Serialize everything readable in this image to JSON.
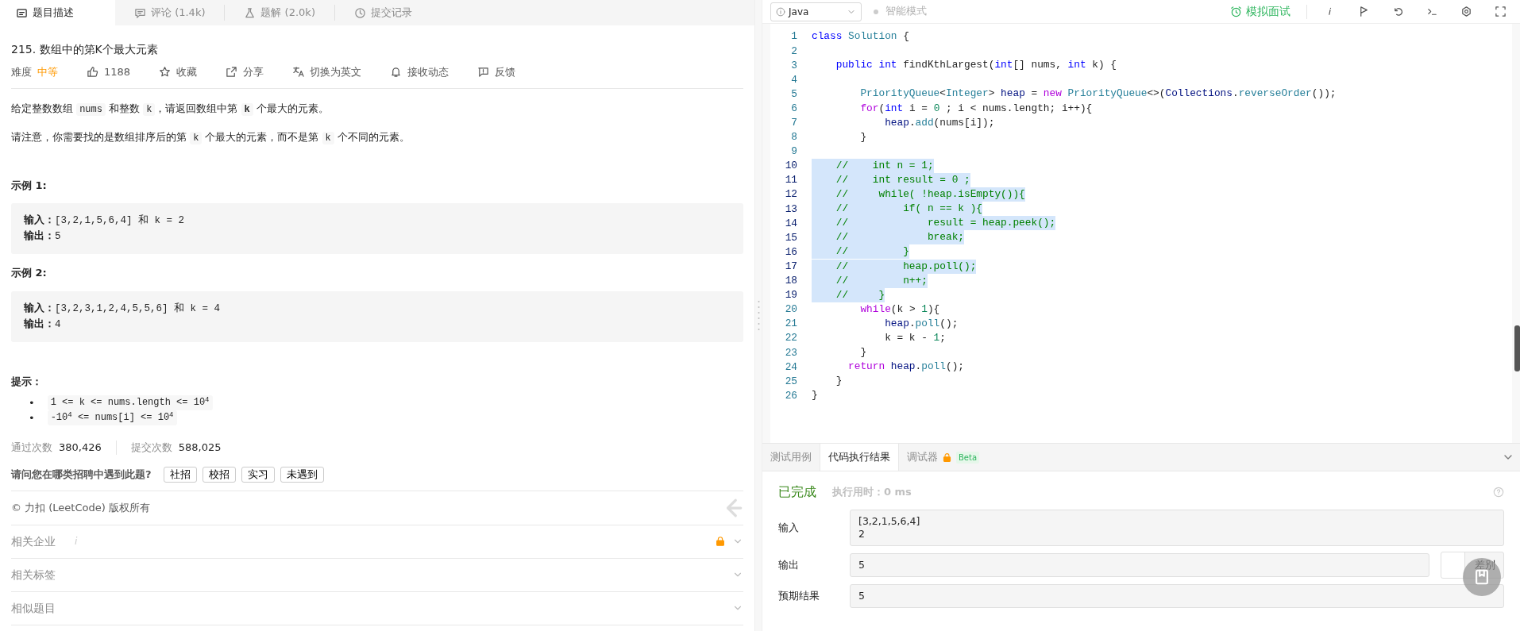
{
  "left_tabs": [
    {
      "label": "题目描述",
      "selected": true
    },
    {
      "label": "评论 (1.4k)",
      "selected": false
    },
    {
      "label": "题解 (2.0k)",
      "selected": false
    },
    {
      "label": "提交记录",
      "selected": false
    }
  ],
  "problem": {
    "title": "215. 数组中的第K个最大元素",
    "difficulty_label": "难度",
    "difficulty": "中等",
    "actions": [
      {
        "label": "1188"
      },
      {
        "label": "收藏"
      },
      {
        "label": "分享"
      },
      {
        "label": "切换为英文"
      },
      {
        "label": "接收动态"
      },
      {
        "label": "反馈"
      }
    ],
    "paragraphs": [
      [
        {
          "kind": "text",
          "text": "给定整数数组 "
        },
        {
          "kind": "code",
          "text": "nums"
        },
        {
          "kind": "text",
          "text": " 和整数 "
        },
        {
          "kind": "code",
          "text": "k"
        },
        {
          "kind": "text",
          "text": "，请返回数组中第 "
        },
        {
          "kind": "strongcode",
          "text": "k"
        },
        {
          "kind": "text",
          "text": " 个最大的元素。"
        }
      ],
      [
        {
          "kind": "text",
          "text": "请注意，你需要找的是数组排序后的第 "
        },
        {
          "kind": "code",
          "text": "k"
        },
        {
          "kind": "text",
          "text": " 个最大的元素，而不是第 "
        },
        {
          "kind": "code",
          "text": "k"
        },
        {
          "kind": "text",
          "text": " 个不同的元素。"
        }
      ]
    ],
    "examples": [
      {
        "title": "示例 1:",
        "lines": [
          "**输入：**[3,2,1,5,6,4] 和 k = 2",
          "**输出：**5"
        ]
      },
      {
        "title": "示例 2:",
        "lines": [
          "**输入：**[3,2,3,1,2,4,5,5,6] 和 k = 4",
          "**输出：**4"
        ]
      }
    ],
    "hints_title": "提示：",
    "hints": [
      {
        "bullet": "•",
        "text": "1 <= k <= nums.length <= 10$^{4}$"
      },
      {
        "bullet": "•",
        "text": "-10$^{4}$  <= nums[i] <= 10$^{4}$"
      }
    ],
    "stats": [
      {
        "label": "通过次数",
        "value": "380,426"
      },
      {
        "label": "提交次数",
        "value": "588,025"
      }
    ],
    "survey": {
      "question": "请问您在哪类招聘中遇到此题?",
      "options": [
        "社招",
        "校招",
        "实习",
        "未遇到"
      ]
    },
    "copyright": "© 力扣 (LeetCode) 版权所有",
    "sections": [
      {
        "label": "相关企业",
        "info": "i",
        "locked": true
      },
      {
        "label": "相关标签",
        "locked": false
      },
      {
        "label": "相似题目",
        "locked": false
      }
    ]
  },
  "toolbar": {
    "language": "Java",
    "smart_mode": "智能模式",
    "mock_interview": "模拟面试"
  },
  "code_lines": [
    {
      "number": "1",
      "selected": false,
      "tokens": [
        {
          "text": "class",
          "kind": "keyword"
        },
        {
          "text": " Solution",
          "kind": "type"
        },
        {
          "text": " {"
        }
      ]
    },
    {
      "number": "2",
      "selected": false
    },
    {
      "number": "3",
      "selected": false,
      "tokens": [
        {
          "text": "    public",
          "kind": "keyword"
        },
        {
          "text": " int",
          "kind": "keyword"
        },
        {
          "text": " findKthLargest("
        },
        {
          "text": "int",
          "kind": "keyword"
        },
        {
          "text": "[] nums, "
        },
        {
          "text": "int",
          "kind": "keyword"
        },
        {
          "text": " k) {"
        }
      ]
    },
    {
      "number": "4",
      "selected": false
    },
    {
      "number": "5",
      "selected": false,
      "tokens": [
        {
          "text": "        PriorityQueue",
          "kind": "type"
        },
        {
          "text": "<"
        },
        {
          "text": "Integer",
          "kind": "type"
        },
        {
          "text": "> "
        },
        {
          "text": "heap",
          "kind": "var"
        },
        {
          "text": " = "
        },
        {
          "text": "new",
          "kind": "control"
        },
        {
          "text": " PriorityQueue",
          "kind": "type"
        },
        {
          "text": "<>("
        },
        {
          "text": "Collections",
          "kind": "var"
        },
        {
          "text": "."
        },
        {
          "text": "reverseOrder",
          "kind": "type"
        },
        {
          "text": "());"
        }
      ]
    },
    {
      "number": "6",
      "selected": false,
      "tokens": [
        {
          "text": "        for",
          "kind": "control"
        },
        {
          "text": "("
        },
        {
          "text": "int",
          "kind": "keyword"
        },
        {
          "text": " i = "
        },
        {
          "text": "0",
          "kind": "number"
        },
        {
          "text": " ; i < nums.length; i++){"
        }
      ]
    },
    {
      "number": "7",
      "selected": false,
      "tokens": [
        {
          "text": "            heap",
          "kind": "var"
        },
        {
          "text": "."
        },
        {
          "text": "add",
          "kind": "type"
        },
        {
          "text": "(nums[i]);"
        }
      ]
    },
    {
      "number": "8",
      "selected": false,
      "tokens": [
        {
          "text": "        }"
        }
      ]
    },
    {
      "number": "9",
      "selected": false
    },
    {
      "number": "10",
      "selected": true,
      "tokens": [
        {
          "text": "    //    int n = 1;",
          "kind": "comment"
        }
      ]
    },
    {
      "number": "11",
      "selected": true,
      "tokens": [
        {
          "text": "    //    int result = 0 ;",
          "kind": "comment"
        }
      ]
    },
    {
      "number": "12",
      "selected": true,
      "tokens": [
        {
          "text": "    //     while( !heap.isEmpty()){",
          "kind": "comment"
        }
      ]
    },
    {
      "number": "13",
      "selected": true,
      "tokens": [
        {
          "text": "    //         if( n == k ){",
          "kind": "comment"
        }
      ]
    },
    {
      "number": "14",
      "selected": true,
      "tokens": [
        {
          "text": "    //             result = heap.peek();",
          "kind": "comment"
        }
      ]
    },
    {
      "number": "15",
      "selected": true,
      "tokens": [
        {
          "text": "    //             break;",
          "kind": "comment"
        }
      ]
    },
    {
      "number": "16",
      "selected": true,
      "tokens": [
        {
          "text": "    //         }",
          "kind": "comment"
        }
      ]
    },
    {
      "number": "17",
      "selected": true,
      "tokens": [
        {
          "text": "    //         heap.poll();",
          "kind": "comment"
        }
      ]
    },
    {
      "number": "18",
      "selected": true,
      "tokens": [
        {
          "text": "    //         n++;",
          "kind": "comment"
        }
      ]
    },
    {
      "number": "19",
      "selected": true,
      "tokens": [
        {
          "text": "    //     }",
          "kind": "comment"
        }
      ]
    },
    {
      "number": "20",
      "selected": false,
      "tokens": [
        {
          "text": "        while",
          "kind": "control"
        },
        {
          "text": "(k > "
        },
        {
          "text": "1",
          "kind": "number"
        },
        {
          "text": "){"
        }
      ]
    },
    {
      "number": "21",
      "selected": false,
      "tokens": [
        {
          "text": "            heap",
          "kind": "var"
        },
        {
          "text": "."
        },
        {
          "text": "poll",
          "kind": "type"
        },
        {
          "text": "();"
        }
      ]
    },
    {
      "number": "22",
      "selected": false,
      "tokens": [
        {
          "text": "            k = k - "
        },
        {
          "text": "1",
          "kind": "number"
        },
        {
          "text": ";"
        }
      ]
    },
    {
      "number": "23",
      "selected": false,
      "tokens": [
        {
          "text": "        }"
        }
      ]
    },
    {
      "number": "24",
      "selected": false,
      "tokens": [
        {
          "text": "      return",
          "kind": "control"
        },
        {
          "text": " heap",
          "kind": "var"
        },
        {
          "text": "."
        },
        {
          "text": "poll",
          "kind": "type"
        },
        {
          "text": "();"
        }
      ]
    },
    {
      "number": "25",
      "selected": false,
      "tokens": [
        {
          "text": "    }"
        }
      ]
    },
    {
      "number": "26",
      "selected": false,
      "tokens": [
        {
          "text": "}"
        }
      ]
    }
  ],
  "result_tabs": [
    {
      "label": "测试用例",
      "selected": false,
      "locked": false
    },
    {
      "label": "代码执行结果",
      "selected": true,
      "locked": false
    },
    {
      "label": "调试器",
      "selected": false,
      "locked": true,
      "badge": "Beta"
    }
  ],
  "result": {
    "status": "已完成",
    "runtime": "执行用时：0 ms",
    "rows": [
      {
        "label": "输入",
        "lines": [
          "[3,2,1,5,6,4]",
          "2"
        ]
      },
      {
        "label": "输出",
        "lines": [
          "5"
        ],
        "diff": "差别"
      },
      {
        "label": "预期结果",
        "lines": [
          "5"
        ]
      }
    ]
  }
}
